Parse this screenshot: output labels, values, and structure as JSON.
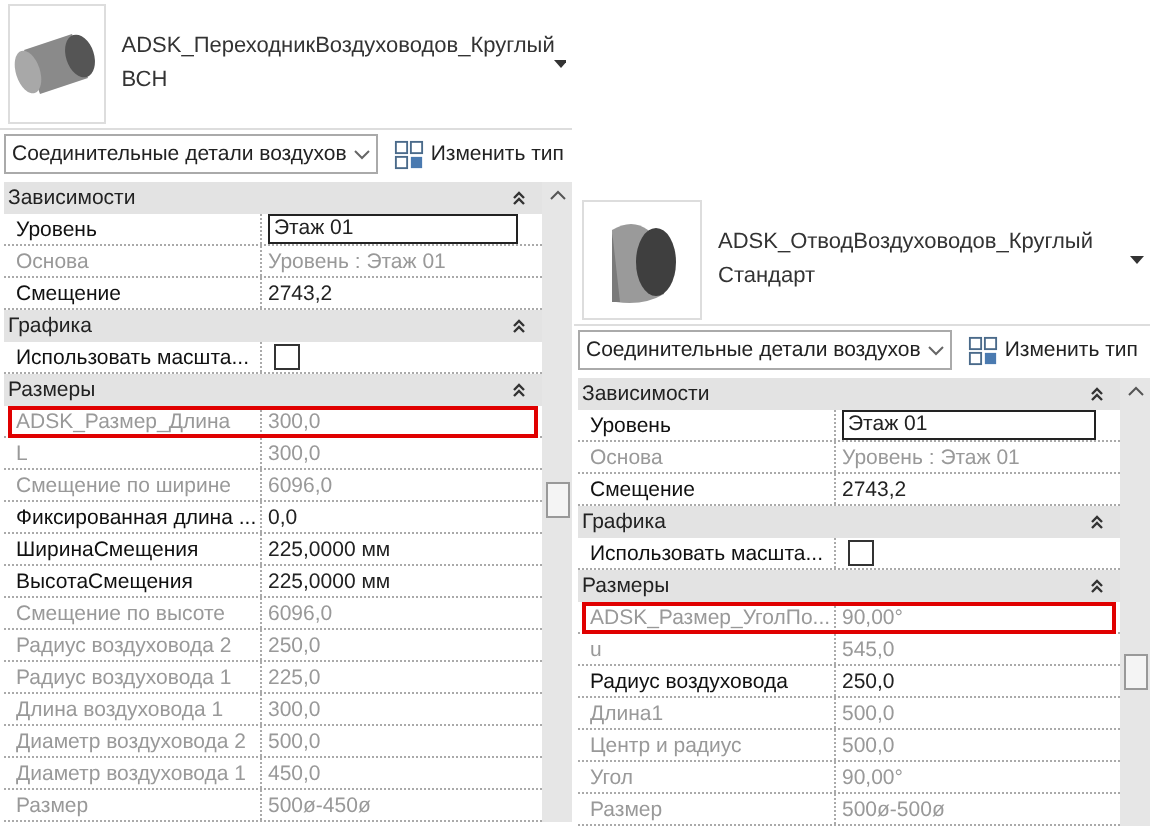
{
  "panels": [
    {
      "type_name": [
        "ADSK_ПереходникВоздуховодов_Круглый",
        "ВСН"
      ],
      "category": "Соединительные детали воздухов",
      "edit_type": "Изменить тип",
      "groups": [
        {
          "title": "Зависимости",
          "rows": [
            {
              "label": "Уровень",
              "kind": "text",
              "value": "Этаж 01",
              "disabled": false,
              "editing": true
            },
            {
              "label": "Основа",
              "kind": "text",
              "value": "Уровень : Этаж 01",
              "disabled": true
            },
            {
              "label": "Смещение",
              "kind": "text",
              "value": "2743,2",
              "disabled": false
            }
          ]
        },
        {
          "title": "Графика",
          "rows": [
            {
              "label": "Использовать масшта...",
              "kind": "checkbox",
              "checked": false,
              "disabled": false
            }
          ]
        },
        {
          "title": "Размеры",
          "rows": [
            {
              "label": "ADSK_Размер_Длина",
              "kind": "text",
              "value": "300,0",
              "disabled": true,
              "highlighted": true
            },
            {
              "label": "L",
              "kind": "text",
              "value": "300,0",
              "disabled": true
            },
            {
              "label": "Смещение по ширине",
              "kind": "text",
              "value": "6096,0",
              "disabled": true
            },
            {
              "label": "Фиксированная длина ...",
              "kind": "text",
              "value": "0,0",
              "disabled": false
            },
            {
              "label": "ШиринаСмещения",
              "kind": "text",
              "value": "225,0000 мм",
              "disabled": false
            },
            {
              "label": "ВысотаСмещения",
              "kind": "text",
              "value": "225,0000 мм",
              "disabled": false
            },
            {
              "label": "Смещение по высоте",
              "kind": "text",
              "value": "6096,0",
              "disabled": true
            },
            {
              "label": "Радиус воздуховода 2",
              "kind": "text",
              "value": "250,0",
              "disabled": true
            },
            {
              "label": "Радиус воздуховода 1",
              "kind": "text",
              "value": "225,0",
              "disabled": true
            },
            {
              "label": "Длина воздуховода 1",
              "kind": "text",
              "value": "300,0",
              "disabled": true
            },
            {
              "label": "Диаметр воздуховода 2",
              "kind": "text",
              "value": "500,0",
              "disabled": true
            },
            {
              "label": "Диаметр воздуховода 1",
              "kind": "text",
              "value": "450,0",
              "disabled": true
            },
            {
              "label": "Размер",
              "kind": "text",
              "value": "500ø-450ø",
              "disabled": true
            }
          ]
        }
      ]
    },
    {
      "type_name": [
        "ADSK_ОтводВоздуховодов_Круглый",
        "Стандарт"
      ],
      "category": "Соединительные детали воздухов",
      "edit_type": "Изменить тип",
      "groups": [
        {
          "title": "Зависимости",
          "rows": [
            {
              "label": "Уровень",
              "kind": "text",
              "value": "Этаж 01",
              "disabled": false,
              "editing": true
            },
            {
              "label": "Основа",
              "kind": "text",
              "value": "Уровень : Этаж 01",
              "disabled": true
            },
            {
              "label": "Смещение",
              "kind": "text",
              "value": "2743,2",
              "disabled": false
            }
          ]
        },
        {
          "title": "Графика",
          "rows": [
            {
              "label": "Использовать масшта...",
              "kind": "checkbox",
              "checked": false,
              "disabled": false
            }
          ]
        },
        {
          "title": "Размеры",
          "rows": [
            {
              "label": "ADSK_Размер_УголПо...",
              "kind": "text",
              "value": "90,00°",
              "disabled": true,
              "highlighted": true
            },
            {
              "label": "u",
              "kind": "text",
              "value": "545,0",
              "disabled": true
            },
            {
              "label": "Радиус воздуховода",
              "kind": "text",
              "value": "250,0",
              "disabled": false
            },
            {
              "label": "Длина1",
              "kind": "text",
              "value": "500,0",
              "disabled": true
            },
            {
              "label": "Центр и радиус",
              "kind": "text",
              "value": "500,0",
              "disabled": true
            },
            {
              "label": "Угол",
              "kind": "text",
              "value": "90,00°",
              "disabled": true
            },
            {
              "label": "Размер",
              "kind": "text",
              "value": "500ø-500ø",
              "disabled": true
            }
          ]
        }
      ]
    }
  ]
}
